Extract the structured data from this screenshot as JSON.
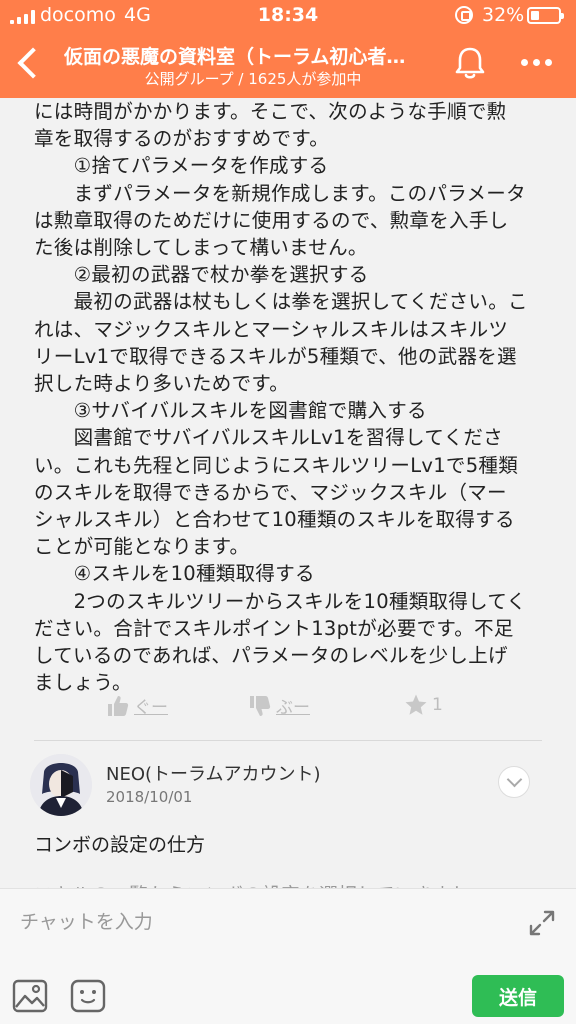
{
  "status_bar": {
    "carrier": "docomo",
    "network": "4G",
    "time": "18:34",
    "battery_pct": "32%",
    "battery_level": 0.32
  },
  "header": {
    "title": "仮面の悪魔の資料室（トーラム初心者…",
    "subtitle": "公開グループ / 1625人が参加中",
    "color": "#ff7e4a"
  },
  "message_lines": [
    "には時間がかかります。そこで、次のような手順で勲",
    "章を取得するのがおすすめです。",
    "　　①捨てパラメータを作成する",
    "　　まずパラメータを新規作成します。このパラメータ",
    "は勲章取得のためだけに使用するので、勲章を入手し",
    "た後は削除してしまって構いません。",
    "　　②最初の武器で杖か拳を選択する",
    "　　最初の武器は杖もしくは拳を選択してください。こ",
    "れは、マジックスキルとマーシャルスキルはスキルツ",
    "リーLv1で取得できるスキルが5種類で、他の武器を選",
    "択した時より多いためです。",
    "　　③サバイバルスキルを図書館で購入する",
    "　　図書館でサバイバルスキルLv1を習得してくださ",
    "い。これも先程と同じようにスキルツリーLv1で5種類",
    "のスキルを取得できるからで、マジックスキル（マー",
    "シャルスキル）と合わせて10種類のスキルを取得する",
    "ことが可能となります。",
    "　　④スキルを10種類取得する",
    "　　2つのスキルツリーからスキルを10種類取得してく",
    "ださい。合計でスキルポイント13ptが必要です。不足",
    "しているのであれば、パラメータのレベルを少し上げ",
    "ましょう。"
  ],
  "reactions": {
    "good_label": "ぐー",
    "bad_label": "ぶー",
    "star_count": "1"
  },
  "comment": {
    "user": "NEO(トーラムアカウント)",
    "date": "2018/10/01",
    "text": "コンボの設定の仕方",
    "next_line_partial": "スキルの一覧からコンボの設定を選択していきまし"
  },
  "input": {
    "placeholder": "チャットを入力",
    "send_label": "送信",
    "send_color": "#2fbd55"
  }
}
